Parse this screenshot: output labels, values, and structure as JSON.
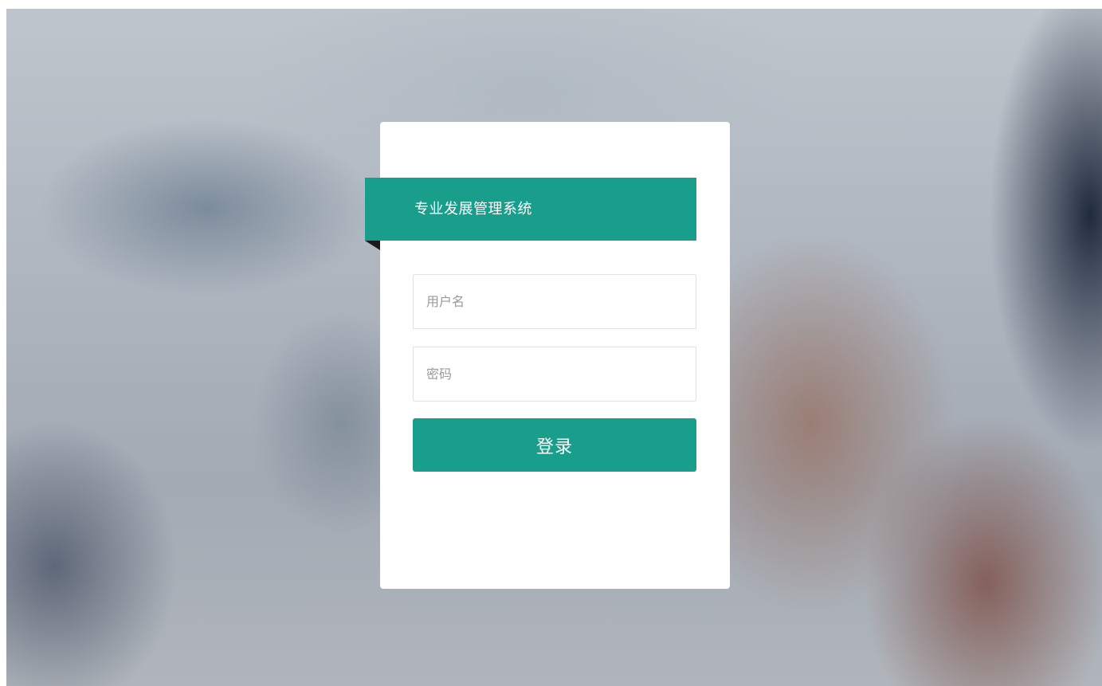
{
  "app": {
    "title": "专业发展管理系统"
  },
  "login": {
    "username_placeholder": "用户名",
    "username_value": "",
    "password_placeholder": "密码",
    "password_value": "",
    "submit_label": "登录"
  },
  "colors": {
    "accent": "#199e8c",
    "card": "#ffffff",
    "ribbon_fold": "#1b1b1b"
  }
}
